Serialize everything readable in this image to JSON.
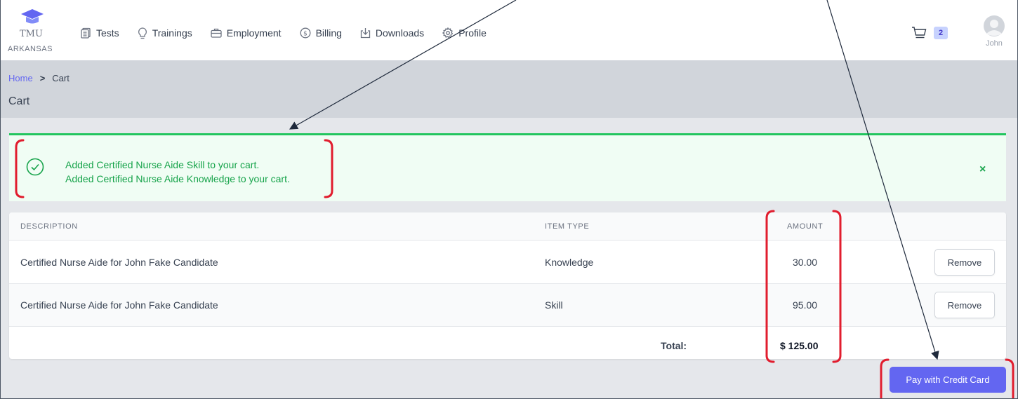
{
  "brand": {
    "line1": "TMU",
    "line2": "ARKANSAS",
    "icon": "graduation-cap-icon"
  },
  "nav": [
    {
      "label": "Tests",
      "icon": "document-icon"
    },
    {
      "label": "Trainings",
      "icon": "lightbulb-icon"
    },
    {
      "label": "Employment",
      "icon": "briefcase-icon"
    },
    {
      "label": "Billing",
      "icon": "dollar-circle-icon"
    },
    {
      "label": "Downloads",
      "icon": "download-icon"
    },
    {
      "label": "Profile",
      "icon": "gear-icon"
    }
  ],
  "cart": {
    "count": "2",
    "icon": "cart-icon"
  },
  "user": {
    "name": "John",
    "icon": "avatar-icon"
  },
  "breadcrumb": {
    "home": "Home",
    "separator": ">",
    "current": "Cart"
  },
  "page_title": "Cart",
  "alert": {
    "lines": [
      "Added Certified Nurse Aide Skill to your cart.",
      "Added Certified Nurse Aide Knowledge to your cart."
    ],
    "close": "×",
    "color": "#16a34a"
  },
  "table": {
    "headers": {
      "description": "DESCRIPTION",
      "item_type": "ITEM TYPE",
      "amount": "AMOUNT"
    },
    "rows": [
      {
        "description": "Certified Nurse Aide for John Fake Candidate",
        "item_type": "Knowledge",
        "amount": "30.00",
        "action": "Remove"
      },
      {
        "description": "Certified Nurse Aide for John Fake Candidate",
        "item_type": "Skill",
        "amount": "95.00",
        "action": "Remove"
      }
    ],
    "total_label": "Total:",
    "total_value": "$ 125.00"
  },
  "pay_button": "Pay with Credit Card",
  "colors": {
    "accent": "#6366f1",
    "success": "#22c55e",
    "annotation_red": "#e11d2e",
    "annotation_arrow": "#1e293b"
  }
}
